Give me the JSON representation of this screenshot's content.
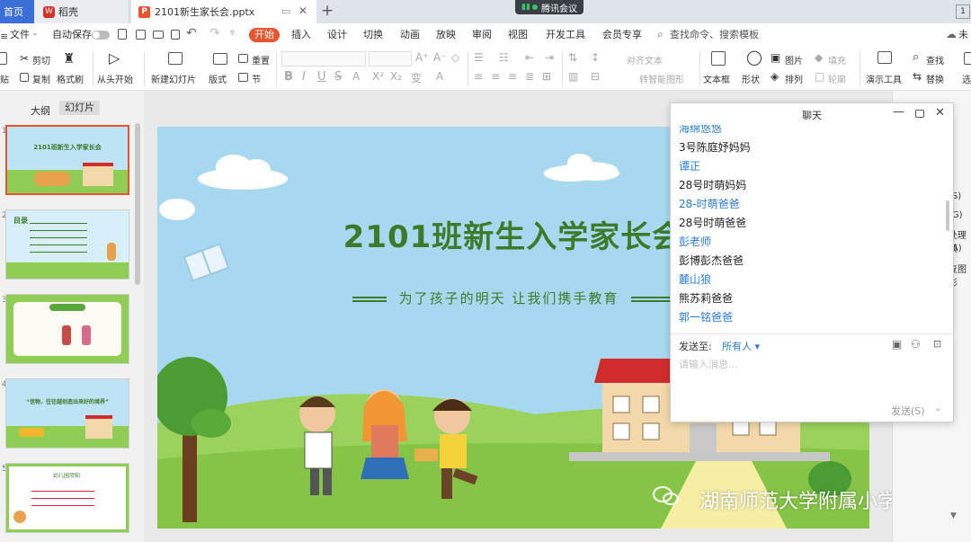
{
  "tabs": {
    "home": "首页",
    "daoke": "稻壳",
    "file": "2101新生家长会.pptx",
    "right_num": "1"
  },
  "meeting_label": "腾讯会议",
  "menu": {
    "file": "文件",
    "autosave": "自动保存",
    "items": [
      "开始",
      "插入",
      "设计",
      "切换",
      "动画",
      "放映",
      "审阅",
      "视图",
      "开发工具",
      "会员专享"
    ],
    "search": "查找命令、搜索模板",
    "cloud": "未"
  },
  "ribbon": {
    "paste": "贴",
    "cut": "剪切",
    "copy": "复制",
    "format_painter": "格式刷",
    "from_start": "从头开始",
    "new_slide": "新建幻灯片",
    "layout": "版式",
    "section": "节",
    "reset": "重置",
    "align_text": "对齐文本",
    "convert_smartart": "转智能图形",
    "textbox": "文本框",
    "shape": "形状",
    "picture": "图片",
    "arrange": "排列",
    "fill": "填充",
    "outline": "轮廓",
    "present_tools": "演示工具",
    "find": "查找",
    "replace": "替换",
    "select": "选"
  },
  "view_tabs": {
    "outline": "大纲",
    "slides": "幻灯片"
  },
  "slides_panel": {
    "thumb1_title": "2101班新生入学家长会",
    "thumb2_title": "目录",
    "thumb4_title": "“信物，往往越创造出来好的境界”",
    "thumb5_title": "幼儿园须知"
  },
  "slide": {
    "title": "2101班新生入学家长会",
    "subtitle": "为了孩子的明天 让我们携手教育"
  },
  "watermark": "湖南师范大学附属小学",
  "chat": {
    "title": "聊天",
    "users": [
      "海绵悠悠",
      "3号陈庭妤妈妈",
      "谭正",
      "28号时萌妈妈",
      "28-时萌爸爸",
      "28号时萌爸爸",
      "彭老师",
      "彭博彭杰爸爸",
      "麓山狼",
      "熊苏莉爸爸",
      "郭一铭爸爸"
    ],
    "send_to_label": "发送至:",
    "send_to_value": "所有人",
    "input_placeholder": "请输入消息...",
    "send_button": "发送(S)"
  },
  "right_panel": {
    "items": [
      "(S)",
      "(G)",
      "处理模",
      "(A)",
      "复图形"
    ]
  },
  "colors": {
    "accent": "#e8542d",
    "title_green": "#3d7a2a",
    "chat_blue": "#2a7bd5",
    "sky": "#a8d8f0",
    "grass": "#8fcd54"
  }
}
